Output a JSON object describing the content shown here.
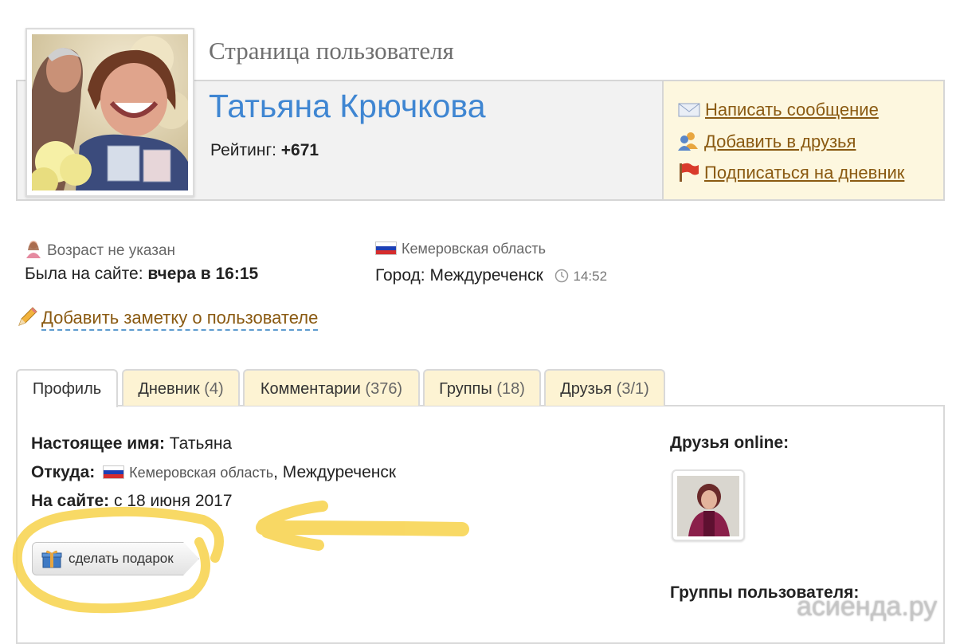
{
  "header": {
    "page_heading": "Страница пользователя",
    "user_name": "Татьяна Крючкова",
    "rating_label": "Рейтинг:",
    "rating_value": "+671"
  },
  "actions": {
    "send_message": "Написать сообщение",
    "add_friend": "Добавить в друзья",
    "subscribe_diary": "Подписаться на дневник"
  },
  "info": {
    "age": "Возраст не указан",
    "last_seen_label": "Была на сайте:",
    "last_seen_value": "вчера в 16:15",
    "region": "Кемеровская область",
    "city_label": "Город:",
    "city_value": "Междуреченск",
    "local_time": "14:52",
    "add_note": "Добавить заметку о пользователе"
  },
  "tabs": [
    {
      "label": "Профиль",
      "count": ""
    },
    {
      "label": "Дневник",
      "count": "(4)"
    },
    {
      "label": "Комментарии",
      "count": "(376)"
    },
    {
      "label": "Группы",
      "count": "(18)"
    },
    {
      "label": "Друзья",
      "count": "(3/1)"
    }
  ],
  "profile": {
    "real_name_label": "Настоящее имя:",
    "real_name_value": "Татьяна",
    "from_label": "Откуда:",
    "from_region": "Кемеровская область",
    "from_city": ", Междуреченск",
    "since_label": "На сайте:",
    "since_value": "с 18 июня 2017",
    "gift_button": "сделать подарок"
  },
  "sidebar": {
    "friends_online_title": "Друзья online:",
    "groups_title": "Группы пользователя:"
  },
  "watermark": "асиенда.ру",
  "colors": {
    "name_blue": "#3f86d2",
    "link_brown": "#8a5a12",
    "panel_yellow": "#fdf7df",
    "tab_yellow": "#fdf3d3",
    "highlighter": "#f7d24a"
  },
  "icons": {
    "send_message": "envelope-icon",
    "add_friend": "users-icon",
    "subscribe_diary": "flag-icon",
    "age": "woman-icon",
    "add_note": "pencil-icon",
    "local_time": "clock-icon",
    "gift": "gift-icon"
  }
}
